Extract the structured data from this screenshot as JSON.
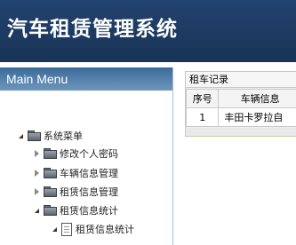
{
  "header": {
    "title": "汽车租赁管理系统"
  },
  "sidebar": {
    "menu_title": "Main Menu",
    "tree": {
      "root": "系统菜单",
      "items": [
        {
          "label": "修改个人密码"
        },
        {
          "label": "车辆信息管理"
        },
        {
          "label": "租赁信息管理"
        },
        {
          "label": "租赁信息统计",
          "children": [
            {
              "label": "租赁信息统计"
            }
          ]
        }
      ]
    }
  },
  "content": {
    "panel_title": "租车记录",
    "table": {
      "headers": [
        "序号",
        "车辆信息"
      ],
      "rows": [
        [
          "1",
          "丰田卡罗拉自"
        ]
      ]
    }
  }
}
